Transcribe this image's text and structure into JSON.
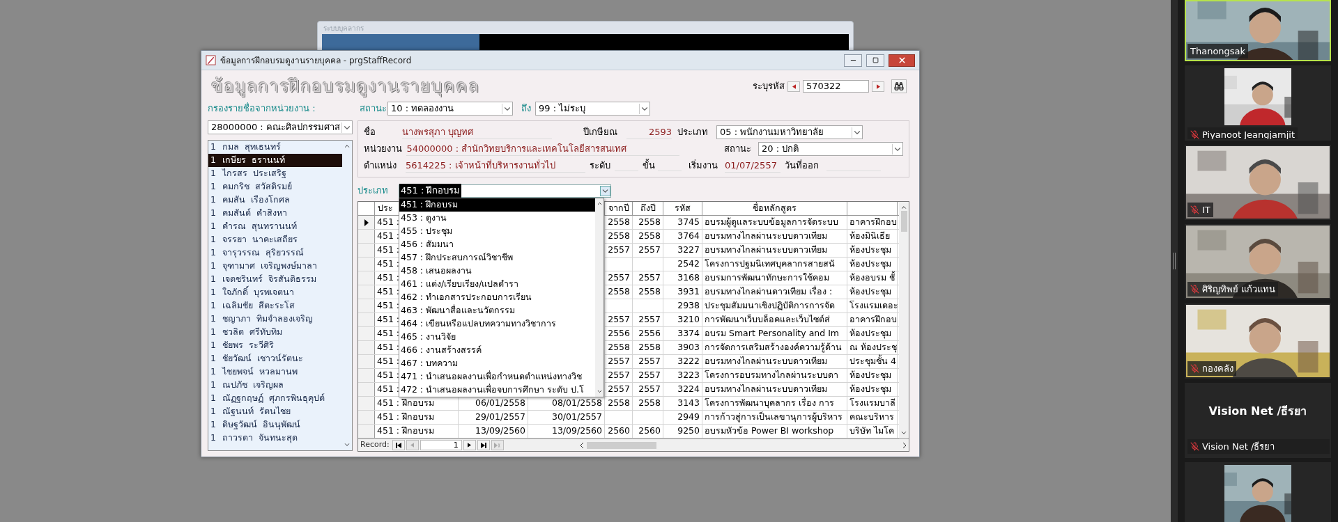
{
  "back_window": {
    "title": "ระบบบุคลากร"
  },
  "window": {
    "title": "ข้อมูลการฝึกอบรมดูงานรายบุคคล - prgStaffRecord"
  },
  "form_title": "ข้อมูลการฝึกอบรมดูงานรายบุคคล",
  "record_lookup": {
    "label": "ระบุรหัส",
    "value": "570322"
  },
  "filter": {
    "label": "กรองรายชื่อจากหน่วยงาน :",
    "department": "28000000 : คณะศิลปกรรมศาส"
  },
  "status_filter": {
    "label": "สถานะ",
    "from": "10 : ทดลองงาน",
    "to_label": "ถึง",
    "to": "99 : ไม่ระบุ"
  },
  "staff_list": [
    {
      "num": "1",
      "name": "กมล  สุทเธนทร์",
      "selected": false
    },
    {
      "num": "1",
      "name": "เกษียร  ธรานนท์",
      "selected": true
    },
    {
      "num": "1",
      "name": "ไกรสร  ประเสริฐ",
      "selected": false
    },
    {
      "num": "1",
      "name": "คมกริช  สวัสดิรมย์",
      "selected": false
    },
    {
      "num": "1",
      "name": "คมสัน  เรืองโกศล",
      "selected": false
    },
    {
      "num": "1",
      "name": "คมสันต์  คำสิงหา",
      "selected": false
    },
    {
      "num": "1",
      "name": "คำรณ  สุนทรานนท์",
      "selected": false
    },
    {
      "num": "1",
      "name": "จรรยา  นาคะเสถียร",
      "selected": false
    },
    {
      "num": "1",
      "name": "จารุวรรณ  สุริยวรรณ์",
      "selected": false
    },
    {
      "num": "1",
      "name": "จุฑามาศ  เจริญพงษ์มาลา",
      "selected": false
    },
    {
      "num": "1",
      "name": "เจตชรินทร์  จิรสันติธรรม",
      "selected": false
    },
    {
      "num": "1",
      "name": "ใจภักดิ์  บุรพเจตนา",
      "selected": false
    },
    {
      "num": "1",
      "name": "เฉลิมชัย  สีตะระโส",
      "selected": false
    },
    {
      "num": "1",
      "name": "ชญาภา  ทิมจำลองเจริญ",
      "selected": false
    },
    {
      "num": "1",
      "name": "ชวลิต  ศรีทับทิม",
      "selected": false
    },
    {
      "num": "1",
      "name": "ชัยพร  ระวีศิริ",
      "selected": false
    },
    {
      "num": "1",
      "name": "ชัยวัฒน์  เชาวน์รัตนะ",
      "selected": false
    },
    {
      "num": "1",
      "name": "ไชยพจน์  หวลมานพ",
      "selected": false
    },
    {
      "num": "1",
      "name": "ณปภัช  เจริญผล",
      "selected": false
    },
    {
      "num": "1",
      "name": "ณัฏฐกฤษฏ์  ศุภกรพินธุคุปต์",
      "selected": false
    },
    {
      "num": "1",
      "name": "ณัฐนนท์  รัตนไชย",
      "selected": false
    },
    {
      "num": "1",
      "name": "ดิษฐวัฒน์  อินนุพัฒน์",
      "selected": false
    },
    {
      "num": "1",
      "name": "ถาวรดา  จันทนะสุด",
      "selected": false
    }
  ],
  "profile": {
    "name_label": "ชื่อ",
    "name": "นางพรสุภา บุญทศ",
    "retire_label": "ปีเกษียณ",
    "retire_year": "2593",
    "type_label": "ประเภท",
    "type": "05 : พนักงานมหาวิทยาลัย",
    "unit_label": "หน่วยงาน",
    "unit": "54000000 : สำนักวิทยบริการและเทคโนโลยีสารสนเทศ",
    "status_label": "สถานะ",
    "status": "20 : ปกติ",
    "position_label": "ตำแหน่ง",
    "position": "5614225 : เจ้าหน้าที่บริหารงานทั่วไป",
    "level_label": "ระดับ",
    "step_label": "ขั้น",
    "start_label": "เริ่มงาน",
    "start_date": "01/07/2557",
    "leave_label": "วันที่ออก"
  },
  "type_filter": {
    "label": "ประเภท",
    "value": "451 : ฝึกอบรม",
    "expanded": true,
    "options": [
      {
        "label": "451 : ฝึกอบรม",
        "selected": true
      },
      {
        "label": "453 : ดูงาน",
        "selected": false
      },
      {
        "label": "455 : ประชุม",
        "selected": false
      },
      {
        "label": "456 : สัมมนา",
        "selected": false
      },
      {
        "label": "457 : ฝึกประสบการณ์วิชาชีพ",
        "selected": false
      },
      {
        "label": "458 : เสนอผลงาน",
        "selected": false
      },
      {
        "label": "461 : แต่ง/เรียบเรียง/แปลตำรา",
        "selected": false
      },
      {
        "label": "462 : ทำเอกสารประกอบการเรียน",
        "selected": false
      },
      {
        "label": "463 : พัฒนาสื่อและนวัตกรรม",
        "selected": false
      },
      {
        "label": "464 : เขียนหรือแปลบทความทางวิชาการ",
        "selected": false
      },
      {
        "label": "465 : งานวิจัย",
        "selected": false
      },
      {
        "label": "466 : งานสร้างสรรค์",
        "selected": false
      },
      {
        "label": "467 : บทความ",
        "selected": false
      },
      {
        "label": "471 : นำเสนอผลงานเพื่อกำหนดตำแหน่งทางวิช",
        "selected": false
      },
      {
        "label": "472 : นำเสนอผลงานเพื่อจบการศึกษา ระดับ ป.โ",
        "selected": false
      }
    ]
  },
  "table": {
    "header": {
      "type": "ประ",
      "from_year": "จากปี",
      "to_year": "ถึงปี",
      "code": "รหัส",
      "course": "ชื่อหลักสูตร"
    },
    "rows": [
      {
        "selected": true,
        "type": "451 :",
        "from_year": "2558",
        "to_year": "2558",
        "code": "3745",
        "course": "อบรมผู้ดูแลระบบข้อมูลการจัดระบบ",
        "column_9": "อาคารฝึกอบ"
      },
      {
        "selected": false,
        "type": "451 :",
        "from_year": "2558",
        "to_year": "2558",
        "code": "3764",
        "course": "อบรมทางไกลผ่านระบบดาวเทียม",
        "column_9": "ห้องมินิเธีย"
      },
      {
        "selected": false,
        "type": "451 :",
        "from_year": "2557",
        "to_year": "2557",
        "code": "3227",
        "course": "อบรมทางไกลผ่านระบบดาวเทียม",
        "column_9": "ห้องประชุม"
      },
      {
        "selected": false,
        "type": "451 :",
        "code": "2542",
        "course": "โครงการปฐมนิเทศบุคลากรสายสนั",
        "column_9": "ห้องประชุม"
      },
      {
        "selected": false,
        "type": "451 :",
        "from_year": "2557",
        "to_year": "2557",
        "code": "3168",
        "course": "อบรมการพัฒนาทักษะการใช้คอม",
        "column_9": "ห้องอบรม ชั้"
      },
      {
        "selected": false,
        "type": "451 :",
        "from_year": "2558",
        "to_year": "2558",
        "code": "3931",
        "course": "อบรมทางไกลผ่านดาวเทียม เรื่อง :",
        "column_9": "ห้องประชุม"
      },
      {
        "selected": false,
        "type": "451 :",
        "code": "2938",
        "course": "ประชุมสัมมนาเชิงปฏิบัติการการจัด",
        "column_9": "โรงแรมเดอะ"
      },
      {
        "selected": false,
        "type": "451 :",
        "from_year": "2557",
        "to_year": "2557",
        "code": "3210",
        "course": "การพัฒนาเว็บบล็อคและเว็บไซต์ส่",
        "column_9": "อาคารฝึกอบ"
      },
      {
        "selected": false,
        "type": "451 :",
        "from_year": "2556",
        "to_year": "2556",
        "code": "3374",
        "course": "อบรม Smart Personality and Im",
        "column_9": "ห้องประชุม"
      },
      {
        "selected": false,
        "type": "451 :",
        "from_year": "2558",
        "to_year": "2558",
        "code": "3903",
        "course": "การจัดการเสริมสร้างองค์ความรู้ด้าน",
        "column_9": "ณ ห้องประชุ"
      },
      {
        "selected": false,
        "type": "451 :",
        "from_year": "2557",
        "to_year": "2557",
        "code": "3222",
        "course": "อบรมทางไกลผ่านระบบดาวเทียม",
        "column_9": "ประชุมชั้น 4"
      },
      {
        "selected": false,
        "type": "451 :",
        "from_year": "2557",
        "to_year": "2557",
        "code": "3223",
        "course": "โครงการอบรมทางไกลผ่านระบบดา",
        "column_9": "ห้องประชุม"
      },
      {
        "selected": false,
        "type": "451 :",
        "from_year": "2557",
        "to_year": "2557",
        "code": "3224",
        "course": "อบรมทางไกลผ่านระบบดาวเทียม",
        "column_9": "ห้องประชุม"
      },
      {
        "selected": false,
        "type": "451 : ฝึกอบรม",
        "start_date": "06/01/2558",
        "end_date": "08/01/2558",
        "from_year": "2558",
        "to_year": "2558",
        "code": "3143",
        "course": "โครงการพัฒนาบุคลากร เรื่อง การ",
        "column_9": "โรงแรมบาลี"
      },
      {
        "selected": false,
        "type": "451 : ฝึกอบรม",
        "start_date": "29/01/2557",
        "end_date": "30/01/2557",
        "code": "2949",
        "course": "การก้าวสู่การเป็นเลขานุการผู้บริหาร",
        "column_9": "คณะบริหาร"
      },
      {
        "selected": false,
        "type": "451 : ฝึกอบรม",
        "start_date": "13/09/2560",
        "end_date": "13/09/2560",
        "from_year": "2560",
        "to_year": "2560",
        "code": "9250",
        "course": "อบรมหัวข้อ Power BI workshop",
        "column_9": "บริษัท ไมโค"
      }
    ]
  },
  "record_nav": {
    "label": "Record:",
    "value": "1"
  },
  "participants": [
    {
      "kind": "video",
      "name": "Thanongsak",
      "muted": false,
      "speaking": true
    },
    {
      "kind": "portrait",
      "name": "Piyanoot Jeangjamjit",
      "muted": true,
      "speaking": false
    },
    {
      "kind": "video",
      "name": "IT",
      "muted": true,
      "speaking": false
    },
    {
      "kind": "video",
      "name": "ศิริญทิพย์ แก้วแทน",
      "muted": true,
      "speaking": false
    },
    {
      "kind": "video",
      "name": "กองคลัง",
      "muted": true,
      "speaking": false
    },
    {
      "kind": "name_card",
      "title": "Vision Net /ธีรยา",
      "name": "Vision Net /ธีรยา",
      "muted": true,
      "speaking": false
    },
    {
      "kind": "portrait",
      "speaking": false
    }
  ]
}
